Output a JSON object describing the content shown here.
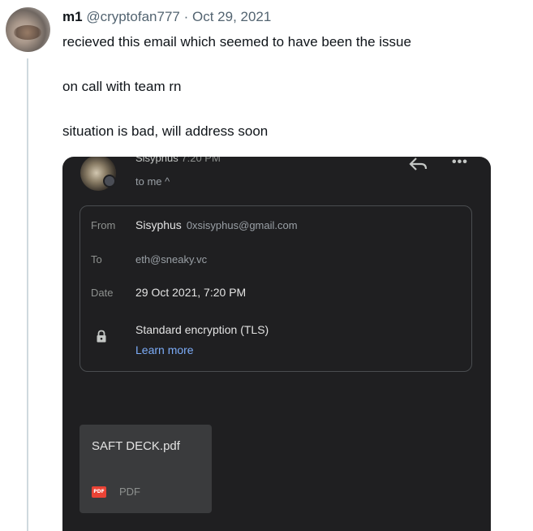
{
  "tweet": {
    "author_name": "m1",
    "handle": "@cryptofan777",
    "separator": "·",
    "date": "Oct 29, 2021",
    "lines": [
      "recieved this email which seemed to have been the issue",
      "on call with team rn",
      "situation is bad, will address soon"
    ]
  },
  "email": {
    "sender_cut": "Sisyphus",
    "time_cut": "7:20 PM",
    "to_me": "to me ^",
    "details": {
      "from_label": "From",
      "from_name": "Sisyphus",
      "from_email": "0xsisyphus@gmail.com",
      "to_label": "To",
      "to_value": "eth@sneaky.vc",
      "date_label": "Date",
      "date_value": "29 Oct 2021, 7:20 PM",
      "encryption": "Standard encryption (TLS)",
      "learn_more": "Learn more"
    },
    "attachment": {
      "name": "SAFT DECK.pdf",
      "badge": "PDF",
      "type": "PDF"
    }
  },
  "colors": {
    "email_bg": "#1f1f21",
    "link": "#7cacf8",
    "pdf_red": "#ea4335"
  },
  "icons": [
    "reply-icon",
    "more-options-icon",
    "lock-icon",
    "pdf-icon"
  ]
}
